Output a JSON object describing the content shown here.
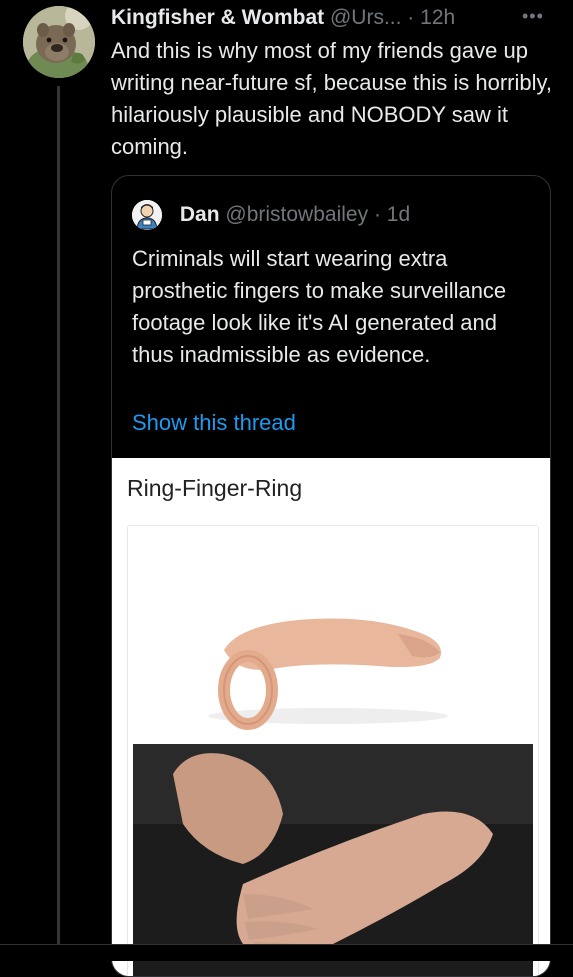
{
  "tweet": {
    "display_name": "Kingfisher & Wombat",
    "handle": "@Urs...",
    "separator": "·",
    "time": "12h",
    "more": "•••",
    "text": "And this is why most of my friends gave up writing near-future sf, because this is horribly, hilariously plausible and NOBODY saw it coming."
  },
  "quote": {
    "display_name": "Dan",
    "handle": "@bristowbailey",
    "separator": "·",
    "time": "1d",
    "text": "Criminals will start wearing extra prosthetic fingers to make surveillance footage look like it's AI generated and thus inadmissible as evidence.",
    "show_thread": "Show this thread",
    "media": {
      "title": "Ring-Finger-Ring"
    }
  },
  "colors": {
    "background": "#000000",
    "text_primary": "#e7e9ea",
    "text_secondary": "#71767b",
    "link": "#1d9bf0",
    "border": "#2f3336"
  }
}
